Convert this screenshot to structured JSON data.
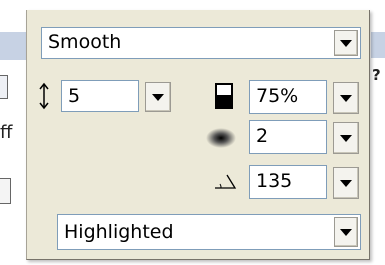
{
  "style_select": {
    "value": "Smooth"
  },
  "distance": {
    "value": "5"
  },
  "opacity": {
    "value": "75%"
  },
  "softness": {
    "value": "2"
  },
  "angle": {
    "value": "135"
  },
  "mode_select": {
    "value": "Highlighted"
  },
  "icons": [
    "vertical-resize-icon",
    "opacity-icon",
    "softness-icon",
    "angle-icon",
    "chevron-down-icon",
    "help-icon"
  ],
  "background": {
    "left_fragment": "ff",
    "right_fragment": "?"
  },
  "colors": {
    "panel": "#ece9d8",
    "field_border": "#7f9db9",
    "background_strip": "#c7d2e4"
  }
}
